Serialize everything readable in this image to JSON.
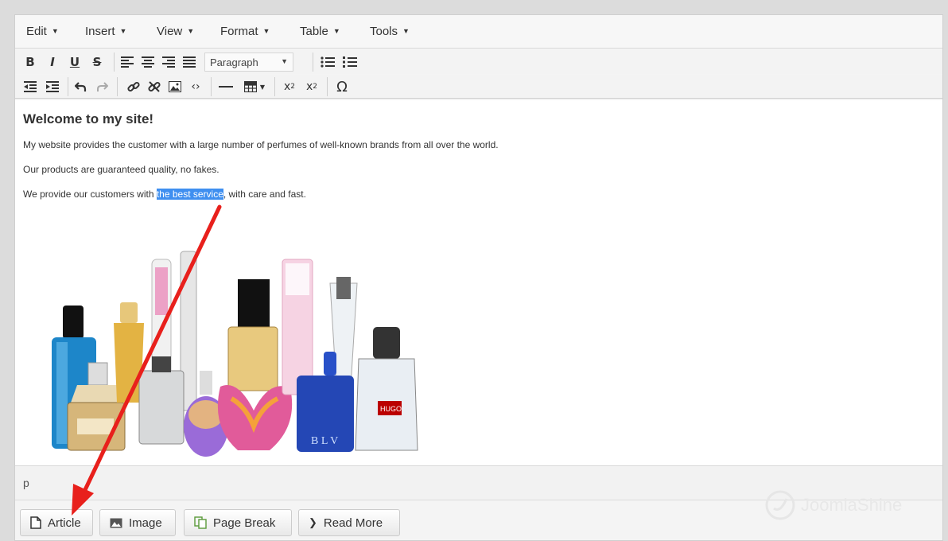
{
  "menubar": {
    "items": [
      {
        "label": "Edit"
      },
      {
        "label": "Insert"
      },
      {
        "label": "View"
      },
      {
        "label": "Format"
      },
      {
        "label": "Table"
      },
      {
        "label": "Tools"
      }
    ]
  },
  "toolbar": {
    "row1": {
      "bold": "B",
      "italic": "I",
      "underline": "U",
      "strike": "S",
      "format_select": "Paragraph"
    },
    "row2": {
      "omega": "Ω"
    }
  },
  "editor": {
    "heading": "Welcome to my site!",
    "paragraphs": [
      "My website provides the customer with a large number of perfumes of well-known brands from all over the world.",
      "Our products are guaranteed quality, no fakes."
    ],
    "p3_before": "We provide our customers with ",
    "p3_selected": "the best service",
    "p3_after": ", with care and fast.",
    "bottle_label": "B L V",
    "label_hugo": "HUGO"
  },
  "statusbar": {
    "path": "p"
  },
  "buttons": {
    "article": "Article",
    "image": "Image",
    "page_break": "Page Break",
    "read_more": "Read More"
  },
  "watermark": {
    "text": "JoomlaShine"
  },
  "colors": {
    "selection": "#3f8ff0",
    "arrow": "#e8201c"
  }
}
